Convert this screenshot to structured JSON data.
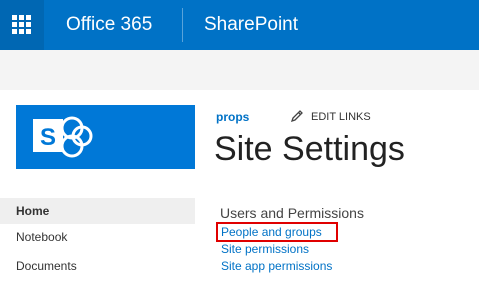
{
  "suite_bar": {
    "app_launcher_icon": "waffle-grid-icon",
    "office_title": "Office 365",
    "product_title": "SharePoint",
    "background_color": "#0072c6"
  },
  "site": {
    "logo_icon": "sharepoint-logo-icon",
    "logo_color": "#0078d7",
    "breadcrumb_link": "props",
    "edit_links_icon": "pencil-icon",
    "edit_links_label": "EDIT LINKS",
    "page_title": "Site Settings"
  },
  "left_nav": {
    "items": [
      {
        "label": "Home",
        "selected": true
      },
      {
        "label": "Notebook",
        "selected": false
      },
      {
        "label": "Documents",
        "selected": false
      }
    ]
  },
  "users_permissions": {
    "heading": "Users and Permissions",
    "links": [
      {
        "label": "People and groups",
        "highlighted": true
      },
      {
        "label": "Site permissions",
        "highlighted": false
      },
      {
        "label": "Site app permissions",
        "highlighted": false
      }
    ],
    "highlight_color": "#e00000"
  }
}
